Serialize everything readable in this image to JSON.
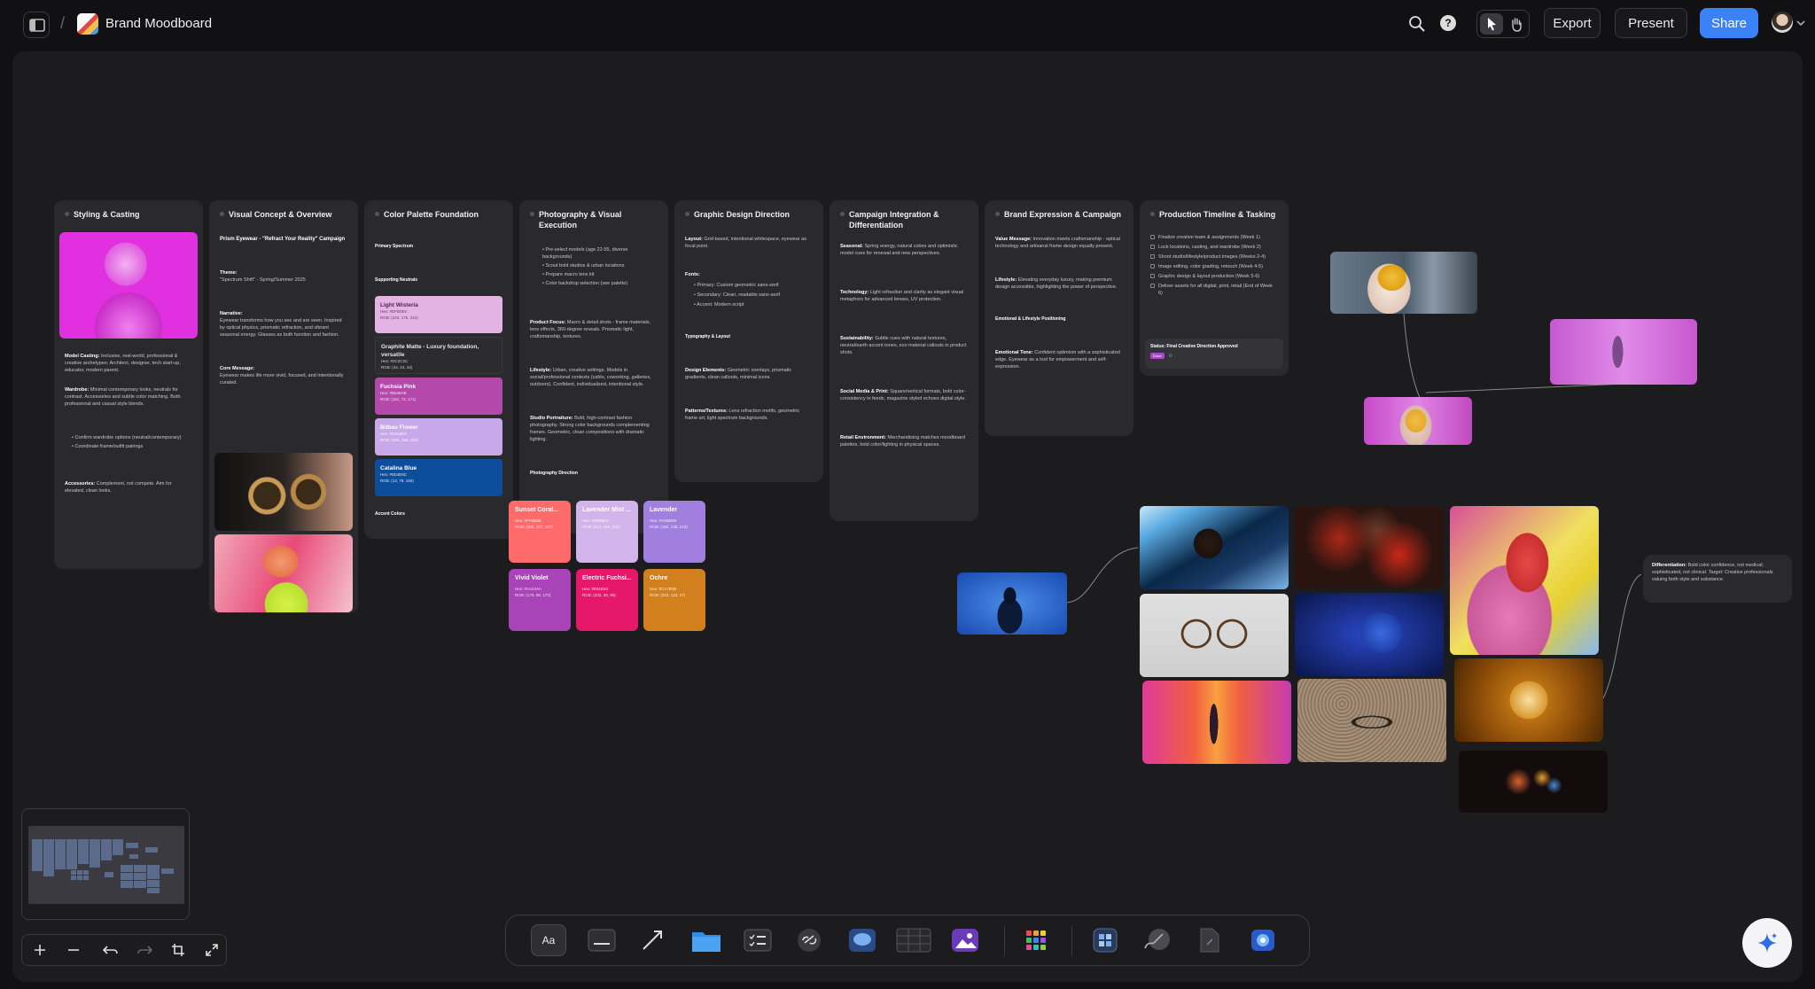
{
  "header": {
    "breadcrumb_sep": "/",
    "title": "Brand Moodboard",
    "export_label": "Export",
    "present_label": "Present",
    "share_label": "Share",
    "accent": "#3b82f6"
  },
  "cards": {
    "styling": {
      "title": "Styling & Casting",
      "model_label": "Model Casting:",
      "model_text": "Inclusive, real-world, professional & creative archetypes: Architect, designer, tech start-up, educator, modern parent.",
      "wardrobe_label": "Wardrobe:",
      "wardrobe_text": "Minimal contemporary looks, neutrals for contrast. Accessories and subtle color matching. Both professional and casual style blends.",
      "bullets": [
        "Confirm wardrobe options (neutral/contemporary)",
        "Coordinate frame/outfit pairings"
      ],
      "accessories_label": "Accessories:",
      "accessories_text": "Complement, not compete. Aim for elevated, clean looks."
    },
    "visual": {
      "title": "Visual Concept & Overview",
      "campaign": "Prism Eyewear - \"Refract Your Reality\" Campaign",
      "theme_label": "Theme:",
      "theme_text": "\"Spectrum Shift\" - Spring/Summer 2025",
      "narrative_label": "Narrative:",
      "narrative_text": "Eyewear transforms how you see and are seen. Inspired by optical physics, prismatic refraction, and vibrant seasonal energy. Glasses as both function and fashion.",
      "core_label": "Core Message:",
      "core_text": "Eyewear makes life more vivid, focused, and intentionally curated."
    },
    "palette": {
      "title": "Color Palette Foundation",
      "primary": "Primary Spectrum",
      "neutrals": "Supporting Neutrals",
      "accents": "Accent Colors",
      "swatches": [
        {
          "name": "Light Wisteria",
          "hex": "Hex: #DFB0E0",
          "rgb": "RGB: (223, 176, 224)",
          "color": "#e4b3e6",
          "text": "#4a2a4c"
        },
        {
          "name": "Graphite Matte - Luxury foundation, versatile",
          "hex": "Hex: #2C2C2C",
          "rgb": "RGB: (44, 44, 44)",
          "color": "#2c2c2e",
          "text": "#e6e6e6"
        },
        {
          "name": "Fuchsia Pink",
          "hex": "Hex: #B548AB",
          "rgb": "RGB: (181, 72, 171)",
          "color": "#b548ab",
          "text": "#ffffff"
        },
        {
          "name": "Bilbao Flower",
          "hex": "Hex: #C8A8E9",
          "rgb": "RGB: (200, 168, 233)",
          "color": "#c8a8e9",
          "text": "#ffffff"
        },
        {
          "name": "Catalina Blue",
          "hex": "Hex: #0D4E9C",
          "rgb": "RGB: (13, 78, 156)",
          "color": "#0d4e9c",
          "text": "#ffffff"
        }
      ]
    },
    "photo": {
      "title": "Photography & Visual Execution",
      "bullets": [
        "Pre-select models (age 22-55, diverse backgrounds)",
        "Scout bold studios & urban locations",
        "Prepare macro lens kit",
        "Color backdrop selection (see palette)"
      ],
      "product_label": "Product Focus:",
      "product_text": "Macro & detail shots - frame materials, lens effects, 360-degree reveals. Prismatic light, craftsmanship, textures.",
      "lifestyle_label": "Lifestyle:",
      "lifestyle_text": "Urban, creative settings. Models in social/professional contexts (cafés, coworking, galleries, outdoors). Confident, individualized, intentional style.",
      "studio_label": "Studio Portraiture:",
      "studio_text": "Bold, high-contrast fashion photography. Strong color backgrounds complementing frames. Geometric, clean compositions with dramatic lighting.",
      "footer": "Photography Direction"
    },
    "graphic": {
      "title": "Graphic Design Direction",
      "layout_label": "Layout:",
      "layout_text": "Grid-based, intentional whitespace, eyewear as focal point.",
      "fonts_label": "Fonts:",
      "fonts": [
        "Primary: Custom geometric sans-serif",
        "Secondary: Clean, readable sans-serif",
        "Accent: Modern script"
      ],
      "typo": "Typography & Layout",
      "design_label": "Design Elements:",
      "design_text": "Geometric overlays, prismatic gradients, clean callouts, minimal icons.",
      "patterns_label": "Patterns/Textures:",
      "patterns_text": "Lens refraction motifs, geometric frame art, light spectrum backgrounds."
    },
    "campaign": {
      "title": "Campaign Integration & Differentiation",
      "seasonal_label": "Seasonal:",
      "seasonal_text": "Spring energy, natural colors and optimistic model cues for renewal and new perspectives.",
      "tech_label": "Technology:",
      "tech_text": "Light refraction and clarity as elegant visual metaphors for advanced lenses, UV protection.",
      "sustain_label": "Sustainability:",
      "sustain_text": "Subtle cues with natural textures, neutral/earth accent tones, eco material callouts in product shots.",
      "social_label": "Social Media & Print:",
      "social_text": "Square/vertical formats, bold color-consistency in feeds, magazine styled echoes digital style.",
      "retail_label": "Retail Environment:",
      "retail_text": "Merchandising matches moodboard palettes, bold color/lighting in physical spaces."
    },
    "brand": {
      "title": "Brand Expression & Campaign",
      "value_label": "Value Message:",
      "value_text": "Innovation meets craftsmanship - optical technology and artisanal frame design equally present.",
      "lifestyle_label": "Lifestyle:",
      "lifestyle_text": "Elevating everyday luxury, making premium design accessible, highlighting the power of perspective.",
      "emotional": "Emotional & Lifestyle Positioning",
      "tone_label": "Emotional Tone:",
      "tone_text": "Confident optimism with a sophisticated edge. Eyewear as a tool for empowerment and self-expression."
    },
    "timeline": {
      "title": "Production Timeline & Tasking",
      "tasks": [
        "Finalize creative team & assignments (Week 1)",
        "Lock locations, casting, and wardrobe (Week 2)",
        "Shoot studio/lifestyle/product images (Weeks 2-4)",
        "Image editing, color grading, retouch (Week 4-5)",
        "Graphic design & layout production (Week 5-6)",
        "Deliver assets for all digital, print, retail (End of Week 6)"
      ],
      "status": "Status: Final Creative Direction Approved",
      "status_tag": "Done"
    }
  },
  "swatches": [
    {
      "name": "Sunset Coral...",
      "hex": "Hex: #FF6B6B",
      "rgb": "RGB: (255, 107, 107)",
      "color": "#ff6b6b"
    },
    {
      "name": "Lavender Mist ...",
      "hex": "Hex: #D6B8E8",
      "rgb": "RGB: (214, 184, 232)",
      "color": "#d3b4ea"
    },
    {
      "name": "Lavender",
      "hex": "Hex: #A08BDB",
      "rgb": "RGB: (160, 139, 219)",
      "color": "#a07fdf"
    },
    {
      "name": "Vivid Violet",
      "hex": "Hex: #AA44AA",
      "rgb": "RGB: (170, 68, 170)",
      "color": "#a944b8"
    },
    {
      "name": "Electric Fuchsi...",
      "hex": "Hex: #E91E63",
      "rgb": "RGB: (233, 30, 99)",
      "color": "#e6186a"
    },
    {
      "name": "Ochre",
      "hex": "Hex: #CA7B1B",
      "rgb": "RGB: (202, 123, 27)",
      "color": "#d2801e"
    }
  ],
  "notes": {
    "differentiation_label": "Differentiation:",
    "differentiation_text": "Bold color confidence, not medical; sophisticated, not clinical. Target: Creative professionals valuing both style and substance."
  }
}
